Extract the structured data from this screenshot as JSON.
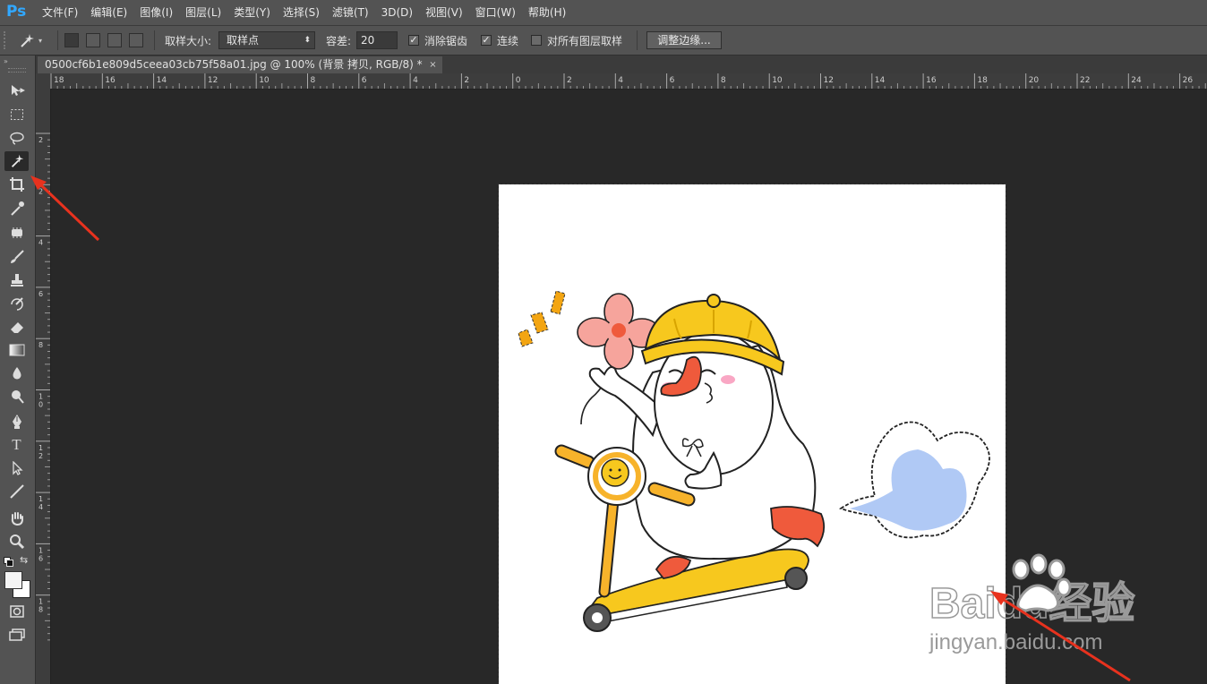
{
  "app": {
    "logo": "Ps"
  },
  "menu": [
    "文件(F)",
    "编辑(E)",
    "图像(I)",
    "图层(L)",
    "类型(Y)",
    "选择(S)",
    "滤镜(T)",
    "3D(D)",
    "视图(V)",
    "窗口(W)",
    "帮助(H)"
  ],
  "options": {
    "sample_size_label": "取样大小:",
    "sample_size_value": "取样点",
    "tolerance_label": "容差:",
    "tolerance_value": "20",
    "antialias_label": "消除锯齿",
    "antialias_checked": true,
    "contiguous_label": "连续",
    "contiguous_checked": true,
    "sample_all_label": "对所有图层取样",
    "sample_all_checked": false,
    "refine_edge_label": "调整边缘..."
  },
  "document": {
    "tab_title": "0500cf6b1e809d5ceea03cb75f58a01.jpg @ 100% (背景 拷贝, RGB/8) *",
    "close_glyph": "×"
  },
  "ruler_h": [
    "18",
    "16",
    "14",
    "12",
    "10",
    "8",
    "6",
    "4",
    "2",
    "0",
    "2",
    "4",
    "6",
    "8",
    "10",
    "12",
    "14",
    "16",
    "18",
    "20",
    "22",
    "24",
    "26"
  ],
  "ruler_v": [
    "2",
    "2",
    "4",
    "6",
    "8",
    "1 0",
    "1 2",
    "1 4",
    "1 6",
    "1 8"
  ],
  "tools": [
    "move-icon",
    "marquee-icon",
    "lasso-icon",
    "magic-wand-icon",
    "crop-icon",
    "eyedropper-icon",
    "healing-brush-icon",
    "brush-icon",
    "clone-stamp-icon",
    "history-brush-icon",
    "eraser-icon",
    "gradient-icon",
    "blur-icon",
    "dodge-icon",
    "pen-icon",
    "type-icon",
    "path-selection-icon",
    "line-icon",
    "hand-icon",
    "zoom-icon"
  ],
  "watermark": {
    "brand": "Baidu经验",
    "url": "jingyan.baidu.com"
  },
  "colors": {
    "ui_bg": "#535353",
    "workspace": "#282828",
    "annotation_arrow": "#e8321e",
    "accent": "#31a8ff"
  }
}
